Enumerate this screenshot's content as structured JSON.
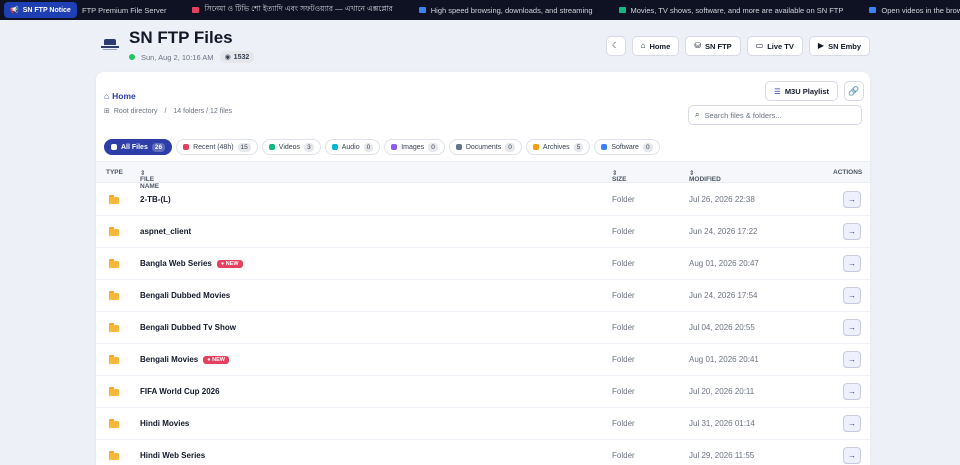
{
  "ticker": {
    "notice_label": "SN FTP Notice",
    "items": [
      {
        "text": "FTP Premium File Server",
        "color": ""
      },
      {
        "text": "সিনেমা ও টিভি শো ইত্যাদি এবং সফটওয়্যার — এখানে এক্সপ্লোর",
        "color": "#e5405e"
      },
      {
        "text": "High speed browsing, downloads, and streaming",
        "color": "#3b82f6"
      },
      {
        "text": "Movies, TV shows, software, and more are available on SN FTP",
        "color": "#10b981"
      },
      {
        "text": "Open videos in the browser",
        "color": "#3b82f6"
      }
    ]
  },
  "header": {
    "title": "SN FTP Files",
    "datetime": "Sun, Aug 2, 10:16 AM",
    "views": "1532",
    "nav": [
      {
        "label": "Home",
        "icon": "home-icon"
      },
      {
        "label": "SN FTP",
        "icon": "network-icon"
      },
      {
        "label": "Live TV",
        "icon": "tv-icon"
      },
      {
        "label": "SN Emby",
        "icon": "play-icon"
      }
    ]
  },
  "browser": {
    "home_label": "Home",
    "root_label": "Root directory",
    "summary": "14 folders / 12 files",
    "m3u_label": "M3U Playlist",
    "search_placeholder": "Search files & folders...",
    "filters": [
      {
        "label": "All Files",
        "count": "26",
        "active": true,
        "color": "#ffffff"
      },
      {
        "label": "Recent (48h)",
        "count": "15",
        "active": false,
        "color": "#e5405e"
      },
      {
        "label": "Videos",
        "count": "3",
        "active": false,
        "color": "#10b981"
      },
      {
        "label": "Audio",
        "count": "0",
        "active": false,
        "color": "#06b6d4"
      },
      {
        "label": "Images",
        "count": "0",
        "active": false,
        "color": "#8b5cf6"
      },
      {
        "label": "Documents",
        "count": "0",
        "active": false,
        "color": "#64748b"
      },
      {
        "label": "Archives",
        "count": "5",
        "active": false,
        "color": "#f59e0b"
      },
      {
        "label": "Software",
        "count": "0",
        "active": false,
        "color": "#3b82f6"
      }
    ],
    "columns": {
      "type": "TYPE",
      "name": "FILE NAME",
      "size": "SIZE",
      "modified": "MODIFIED",
      "actions": "ACTIONS"
    },
    "rows": [
      {
        "name": "2-TB-(L)",
        "size": "Folder",
        "modified": "Jul 26, 2026 22:38",
        "new": false
      },
      {
        "name": "aspnet_client",
        "size": "Folder",
        "modified": "Jun 24, 2026 17:22",
        "new": false
      },
      {
        "name": "Bangla Web Series",
        "size": "Folder",
        "modified": "Aug 01, 2026 20:47",
        "new": true
      },
      {
        "name": "Bengali Dubbed Movies",
        "size": "Folder",
        "modified": "Jun 24, 2026 17:54",
        "new": false
      },
      {
        "name": "Bengali Dubbed Tv Show",
        "size": "Folder",
        "modified": "Jul 04, 2026 20:55",
        "new": false
      },
      {
        "name": "Bengali Movies",
        "size": "Folder",
        "modified": "Aug 01, 2026 20:41",
        "new": true
      },
      {
        "name": "FIFA World Cup 2026",
        "size": "Folder",
        "modified": "Jul 20, 2026 20:11",
        "new": false
      },
      {
        "name": "Hindi Movies",
        "size": "Folder",
        "modified": "Jul 31, 2026 01:14",
        "new": false
      },
      {
        "name": "Hindi Web Series",
        "size": "Folder",
        "modified": "Jul 29, 2026 11:55",
        "new": false
      }
    ],
    "new_badge": "NEW"
  },
  "colors": {
    "accent": "#2d3ea8",
    "new_badge": "#e5405e",
    "folder": "#f6b73c"
  }
}
